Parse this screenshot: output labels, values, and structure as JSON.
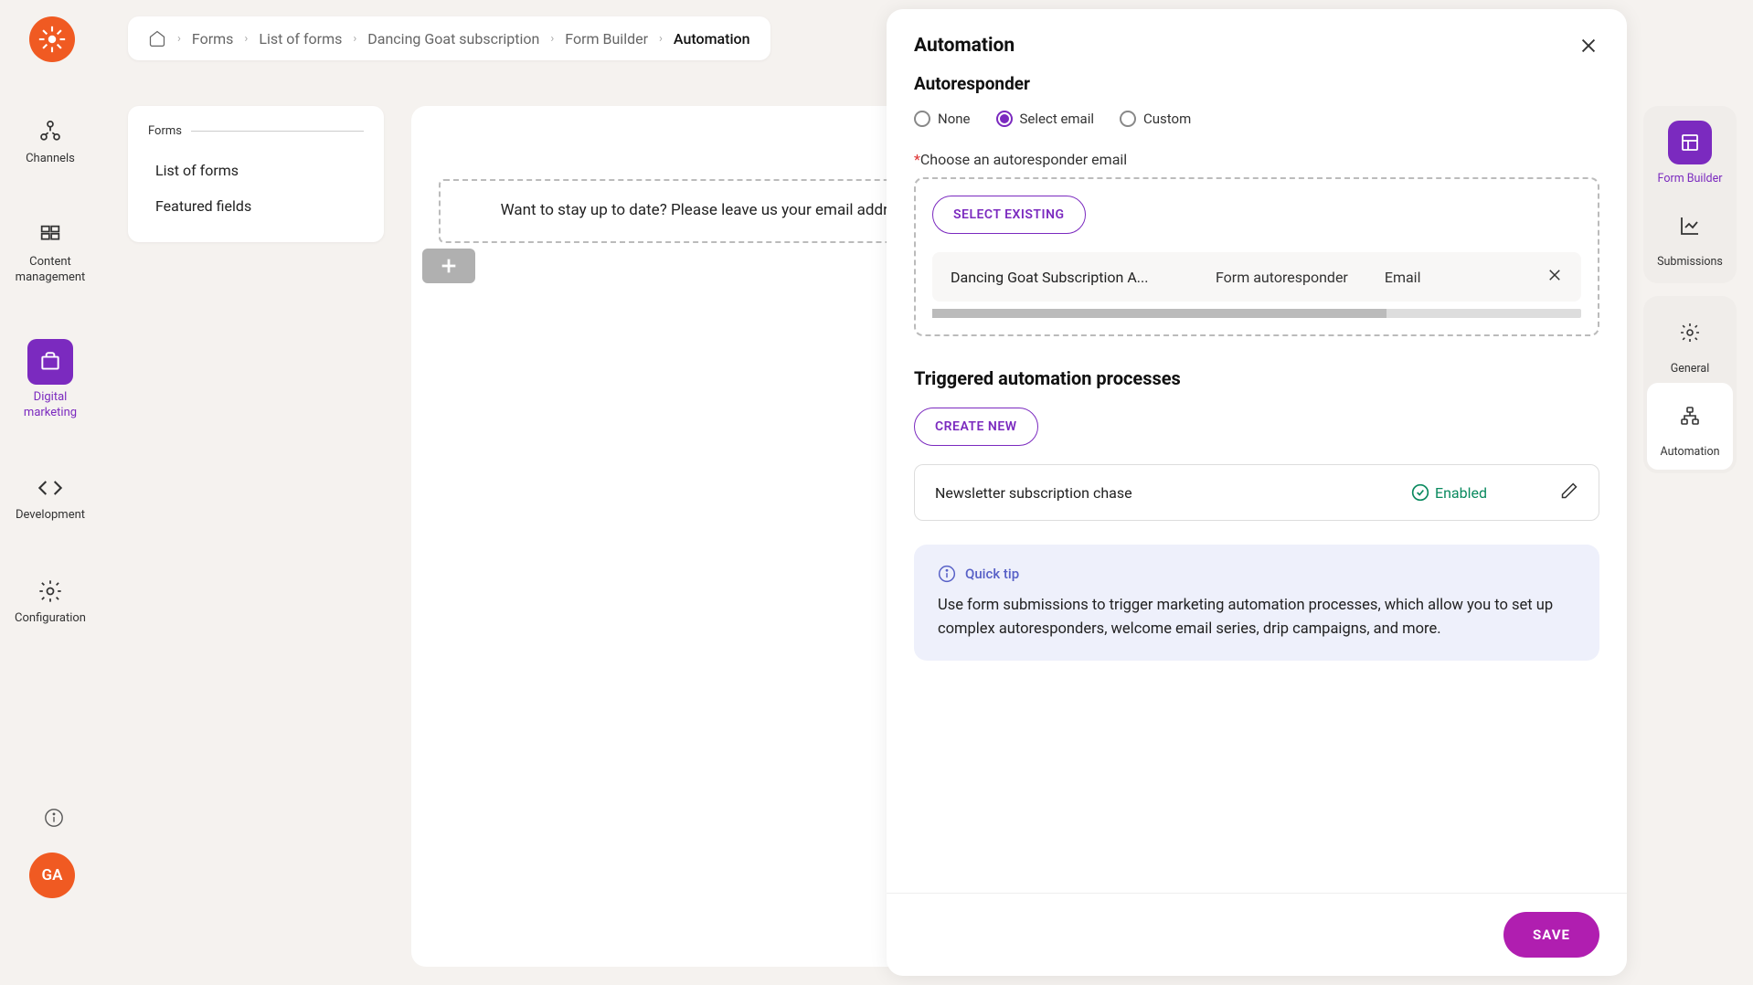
{
  "breadcrumb": {
    "items": [
      "Forms",
      "List of forms",
      "Dancing Goat subscription",
      "Form Builder",
      "Automation"
    ]
  },
  "leftNav": {
    "items": [
      {
        "label": "Channels"
      },
      {
        "label": "Content\nmanagement"
      },
      {
        "label": "Digital\nmarketing",
        "active": true
      },
      {
        "label": "Development"
      },
      {
        "label": "Configuration"
      }
    ]
  },
  "avatar": "GA",
  "subNav": {
    "title": "Forms",
    "items": [
      "List of forms",
      "Featured fields"
    ]
  },
  "canvas": {
    "fieldLabel": "Want to stay up to date? Please leave us your email address:"
  },
  "panel": {
    "title": "Automation",
    "autoresponder": {
      "heading": "Autoresponder",
      "radios": [
        "None",
        "Select email",
        "Custom"
      ],
      "selected": "Select email",
      "chooseLabel": "Choose an autoresponder email",
      "selectExistingLabel": "SELECT EXISTING",
      "selectedEmail": {
        "name": "Dancing Goat Subscription A...",
        "type": "Form autoresponder",
        "channel": "Email"
      }
    },
    "processes": {
      "heading": "Triggered automation processes",
      "createNewLabel": "CREATE NEW",
      "item": {
        "name": "Newsletter subscription chase",
        "status": "Enabled"
      }
    },
    "tip": {
      "label": "Quick tip",
      "text": "Use form submissions to trigger marketing automation processes, which allow you to set up complex autoresponders, welcome email series, drip campaigns, and more."
    },
    "saveLabel": "SAVE"
  },
  "rightNav": {
    "group1": [
      {
        "label": "Form Builder",
        "active": true
      },
      {
        "label": "Submissions"
      }
    ],
    "group2": [
      {
        "label": "General"
      },
      {
        "label": "Automation",
        "highlighted": true
      }
    ]
  }
}
